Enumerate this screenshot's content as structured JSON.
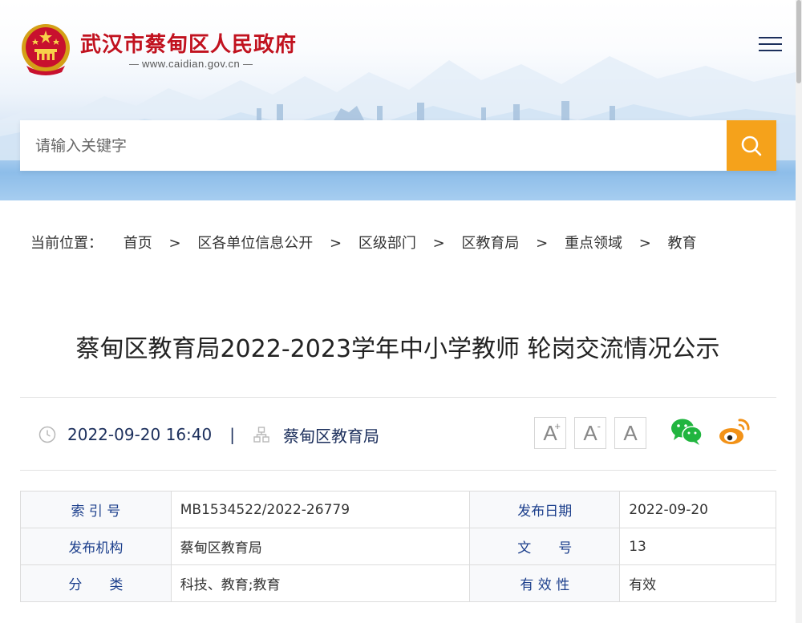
{
  "header": {
    "site_title": "武汉市蔡甸区人民政府",
    "site_url": "www.caidian.gov.cn",
    "menu_icon": "hamburger-menu-icon",
    "colors": {
      "title_red": "#c1121f",
      "accent_orange": "#f5a21b",
      "navy": "#1c2f5c"
    }
  },
  "search": {
    "placeholder": "请输入关键字",
    "value": "",
    "button_icon": "search-icon"
  },
  "breadcrumb": {
    "prefix": "当前位置：",
    "separator": ">",
    "items": [
      "首页",
      "区各单位信息公开",
      "区级部门",
      "区教育局",
      "重点领域",
      "教育"
    ]
  },
  "article": {
    "title": "蔡甸区教育局2022-2023学年中小学教师 轮岗交流情况公示",
    "date": "2022-09-20 16:40",
    "pipe": "|",
    "source": "蔡甸区教育局"
  },
  "font_size_buttons": {
    "large": "A",
    "large_mark": "+",
    "small": "A",
    "small_mark": "-",
    "default": "A"
  },
  "share": {
    "wechat_icon": "wechat-icon",
    "weibo_icon": "weibo-icon"
  },
  "info_table": {
    "rows": [
      {
        "k1": "索 引 号",
        "v1": "MB1534522/2022-26779",
        "k2": "发布日期",
        "v2": "2022-09-20"
      },
      {
        "k1": "发布机构",
        "v1": "蔡甸区教育局",
        "k2": "文　　号",
        "v2": "13"
      },
      {
        "k1": "分　　类",
        "v1": "科技、教育;教育",
        "k2": "有 效 性",
        "v2": "有效"
      }
    ]
  }
}
